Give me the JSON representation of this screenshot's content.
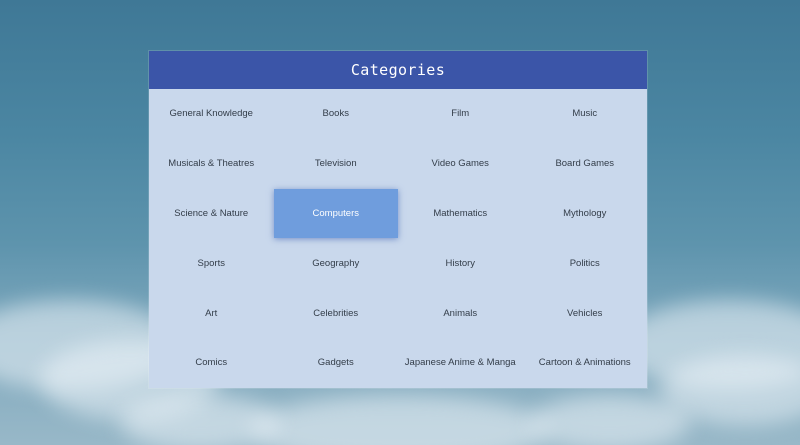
{
  "panel": {
    "title": "Categories"
  },
  "categories": [
    {
      "label": "General Knowledge",
      "selected": false
    },
    {
      "label": "Books",
      "selected": false
    },
    {
      "label": "Film",
      "selected": false
    },
    {
      "label": "Music",
      "selected": false
    },
    {
      "label": "Musicals & Theatres",
      "selected": false
    },
    {
      "label": "Television",
      "selected": false
    },
    {
      "label": "Video Games",
      "selected": false
    },
    {
      "label": "Board Games",
      "selected": false
    },
    {
      "label": "Science & Nature",
      "selected": false
    },
    {
      "label": "Computers",
      "selected": true
    },
    {
      "label": "Mathematics",
      "selected": false
    },
    {
      "label": "Mythology",
      "selected": false
    },
    {
      "label": "Sports",
      "selected": false
    },
    {
      "label": "Geography",
      "selected": false
    },
    {
      "label": "History",
      "selected": false
    },
    {
      "label": "Politics",
      "selected": false
    },
    {
      "label": "Art",
      "selected": false
    },
    {
      "label": "Celebrities",
      "selected": false
    },
    {
      "label": "Animals",
      "selected": false
    },
    {
      "label": "Vehicles",
      "selected": false
    },
    {
      "label": "Comics",
      "selected": false
    },
    {
      "label": "Gadgets",
      "selected": false
    },
    {
      "label": "Japanese Anime & Manga",
      "selected": false
    },
    {
      "label": "Cartoon & Animations",
      "selected": false
    }
  ],
  "colors": {
    "header": "#3b55a8",
    "panel": "#c9d8ec",
    "selected": "#6f9ddd",
    "text": "#333d49"
  }
}
